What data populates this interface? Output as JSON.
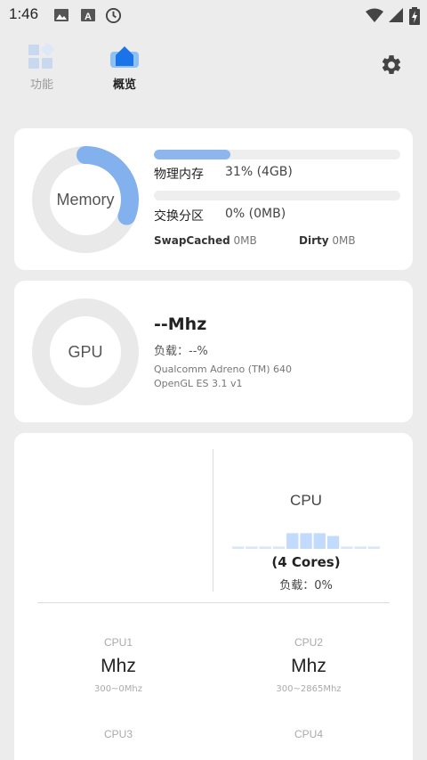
{
  "status_bar": {
    "time": "1:46",
    "icons": [
      "image-icon",
      "text-a-icon",
      "clock-icon",
      "wifi-icon",
      "signal-icon",
      "battery-charging-icon"
    ]
  },
  "nav": {
    "tabs": [
      {
        "label": "功能",
        "icon": "function-grid-icon",
        "active": false
      },
      {
        "label": "概览",
        "icon": "overview-house-icon",
        "active": true
      }
    ],
    "settings_icon": "gear-icon"
  },
  "memory": {
    "ring_label": "Memory",
    "ring_fraction": 0.31,
    "physical": {
      "label": "物理内存",
      "value": "31% (4GB)",
      "fraction": 0.31
    },
    "swap": {
      "label": "交换分区",
      "value": "0% (0MB)",
      "fraction": 0
    },
    "swap_cached": {
      "label": "SwapCached",
      "value": "0MB"
    },
    "dirty": {
      "label": "Dirty",
      "value": "0MB"
    }
  },
  "gpu": {
    "ring_label": "GPU",
    "freq": "--Mhz",
    "load": "负载：--%",
    "renderer": "Qualcomm Adreno (TM) 640",
    "api": "OpenGL ES 3.1 v1"
  },
  "cpu": {
    "title": "CPU",
    "cores": "(4 Cores)",
    "load": "负载：0%",
    "graph_levels": [
      0.08,
      0.08,
      0.08,
      0.08,
      0.55,
      0.55,
      0.55,
      0.45,
      0.08,
      0.08,
      0.08
    ],
    "core_list": [
      {
        "name": "CPU1",
        "freq": "Mhz",
        "range": "300~0Mhz"
      },
      {
        "name": "CPU2",
        "freq": "Mhz",
        "range": "300~2865Mhz"
      },
      {
        "name": "CPU3",
        "freq": "",
        "range": ""
      },
      {
        "name": "CPU4",
        "freq": "",
        "range": ""
      }
    ]
  },
  "colors": {
    "accent": "#1a73e8",
    "bar_fill": "#8fb6ec",
    "ring_track": "#e9e9e9",
    "ring_fill": "#82b1ed",
    "background": "#ececec"
  }
}
